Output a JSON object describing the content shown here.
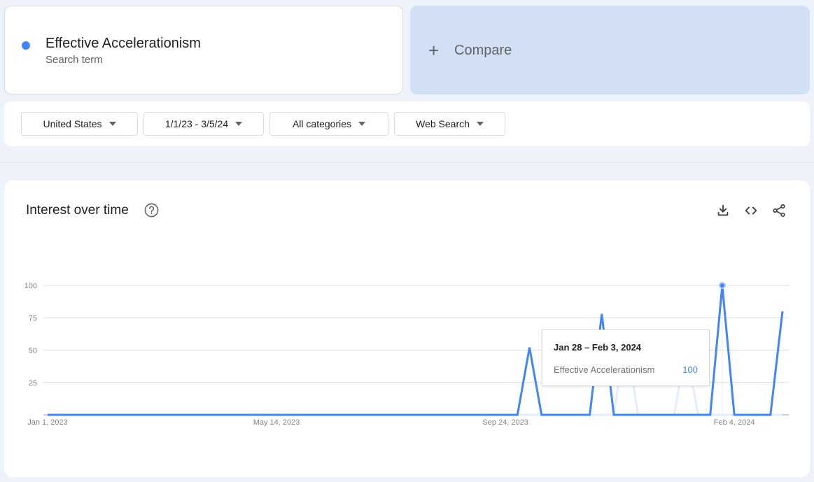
{
  "term": {
    "name": "Effective Accelerationism",
    "subtitle": "Search term",
    "color": "#4285f4"
  },
  "compare": {
    "icon": "plus-icon",
    "label": "Compare"
  },
  "filters": {
    "region": "United States",
    "date_range": "1/1/23 - 3/5/24",
    "category": "All categories",
    "search_type": "Web Search"
  },
  "panel": {
    "title": "Interest over time",
    "help_icon": "help-circle-icon",
    "actions": [
      "download-icon",
      "embed-code-icon",
      "share-icon"
    ]
  },
  "tooltip": {
    "date": "Jan 28 – Feb 3, 2024",
    "series": "Effective Accelerationism",
    "value": "100"
  },
  "chart_data": {
    "type": "line",
    "series_color": "#4285f4",
    "ylim": [
      0,
      100
    ],
    "yticks": [
      "100",
      "75",
      "50",
      "25"
    ],
    "ytick_values": [
      100,
      75,
      50,
      25
    ],
    "xtick_labels": [
      "Jan 1, 2023",
      "May 14, 2023",
      "Sep 24, 2023",
      "Feb 4, 2024"
    ],
    "xtick_weeks": [
      0,
      19,
      38,
      57
    ],
    "grid": true,
    "highlight_week": 56,
    "highlight_label": "Jan 28 – Feb 3, 2024",
    "weeks": 62,
    "values": [
      0,
      0,
      0,
      0,
      0,
      0,
      0,
      0,
      0,
      0,
      0,
      0,
      0,
      0,
      0,
      0,
      0,
      0,
      0,
      0,
      0,
      0,
      0,
      0,
      0,
      0,
      0,
      0,
      0,
      0,
      0,
      0,
      0,
      0,
      0,
      0,
      0,
      0,
      0,
      0,
      52,
      0,
      0,
      0,
      0,
      0,
      78,
      0,
      0,
      0,
      0,
      0,
      0,
      0,
      0,
      0,
      100,
      0,
      0,
      0,
      0,
      80
    ],
    "ghost_values": [
      0,
      0,
      0,
      0,
      0,
      0,
      0,
      0,
      0,
      0,
      0,
      0,
      0,
      0,
      0,
      0,
      0,
      0,
      0,
      0,
      0,
      0,
      0,
      0,
      0,
      0,
      0,
      0,
      0,
      0,
      0,
      0,
      0,
      0,
      0,
      0,
      0,
      0,
      0,
      0,
      0,
      0,
      0,
      0,
      0,
      0,
      0,
      0,
      63,
      0,
      0,
      0,
      0,
      51,
      0,
      0,
      0,
      0,
      0,
      0,
      0,
      0
    ]
  }
}
